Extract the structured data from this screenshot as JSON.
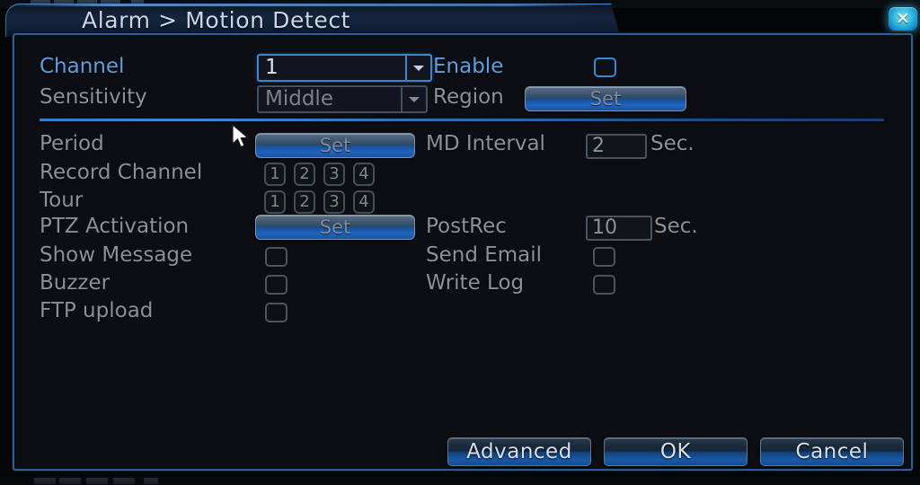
{
  "window": {
    "title": "Alarm > Motion Detect",
    "close_icon": "close-icon",
    "accent_color": "#3f86d0",
    "disabled_text_color": "#8d9097",
    "active_text_color": "#5f9fe0"
  },
  "form": {
    "channel": {
      "label": "Channel",
      "value": "1",
      "enabled": true
    },
    "enable": {
      "label": "Enable",
      "checked": false,
      "enabled": true
    },
    "sensitivity": {
      "label": "Sensitivity",
      "value": "Middle",
      "enabled": false
    },
    "region": {
      "label": "Region",
      "button_label": "Set",
      "enabled": false
    },
    "period": {
      "label": "Period",
      "button_label": "Set",
      "enabled": false
    },
    "md_interval": {
      "label": "MD Interval",
      "value": "2",
      "unit": "Sec.",
      "enabled": false
    },
    "record_channel": {
      "label": "Record Channel",
      "options": [
        "1",
        "2",
        "3",
        "4"
      ],
      "selected": [],
      "enabled": false
    },
    "tour": {
      "label": "Tour",
      "options": [
        "1",
        "2",
        "3",
        "4"
      ],
      "selected": [],
      "enabled": false
    },
    "ptz_activation": {
      "label": "PTZ Activation",
      "button_label": "Set",
      "enabled": false
    },
    "post_rec": {
      "label": "PostRec",
      "value": "10",
      "unit": "Sec.",
      "enabled": false
    },
    "show_message": {
      "label": "Show Message",
      "checked": false,
      "enabled": false
    },
    "send_email": {
      "label": "Send Email",
      "checked": false,
      "enabled": false
    },
    "buzzer": {
      "label": "Buzzer",
      "checked": false,
      "enabled": false
    },
    "write_log": {
      "label": "Write Log",
      "checked": false,
      "enabled": false
    },
    "ftp_upload": {
      "label": "FTP upload",
      "checked": false,
      "enabled": false
    }
  },
  "footer": {
    "advanced_label": "Advanced",
    "ok_label": "OK",
    "cancel_label": "Cancel"
  }
}
